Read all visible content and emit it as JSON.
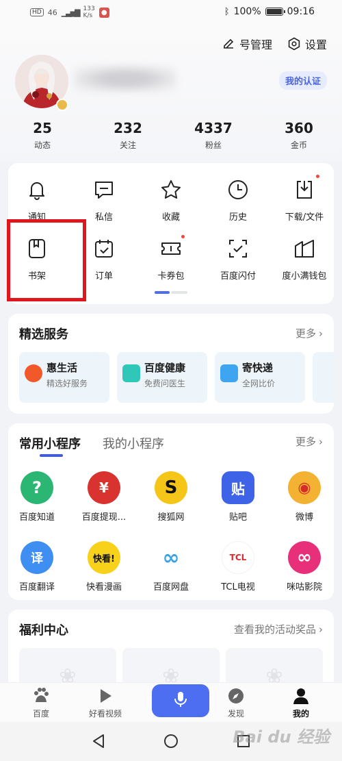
{
  "status_bar": {
    "network": "46",
    "speed_value": "133",
    "speed_unit": "K/s",
    "battery": "100%",
    "time": "09:16"
  },
  "header": {
    "account_mgmt_label": "号管理",
    "settings_label": "设置",
    "certification_label": "我的认证"
  },
  "stats": [
    {
      "value": "25",
      "label": "动态"
    },
    {
      "value": "232",
      "label": "关注"
    },
    {
      "value": "4337",
      "label": "粉丝"
    },
    {
      "value": "360",
      "label": "金币"
    }
  ],
  "quick_actions": [
    {
      "label": "通知",
      "icon": "bell-icon"
    },
    {
      "label": "私信",
      "icon": "message-icon"
    },
    {
      "label": "收藏",
      "icon": "star-icon"
    },
    {
      "label": "历史",
      "icon": "clock-icon"
    },
    {
      "label": "下载/文件",
      "icon": "download-icon",
      "dot": true
    },
    {
      "label": "书架",
      "icon": "bookshelf-icon",
      "highlighted": true
    },
    {
      "label": "订单",
      "icon": "order-icon"
    },
    {
      "label": "卡券包",
      "icon": "ticket-icon",
      "dot": true
    },
    {
      "label": "百度闪付",
      "icon": "scan-pay-icon"
    },
    {
      "label": "度小满钱包",
      "icon": "wallet-icon"
    }
  ],
  "services": {
    "title": "精选服务",
    "more": "更多",
    "items": [
      {
        "title": "惠生活",
        "subtitle": "精选好服务",
        "icon_color": "#f2592a"
      },
      {
        "title": "百度健康",
        "subtitle": "免费问医生",
        "icon_color": "#2fc7b8"
      },
      {
        "title": "寄快递",
        "subtitle": "全网比价",
        "icon_color": "#3ea5f0"
      }
    ]
  },
  "mini_programs": {
    "tab_common": "常用小程序",
    "tab_mine": "我的小程序",
    "more": "更多",
    "apps": [
      {
        "label": "百度知道",
        "color": "#2bb673",
        "glyph": "?"
      },
      {
        "label": "百度提现...",
        "color": "#d9332f",
        "glyph": "¥"
      },
      {
        "label": "搜狐网",
        "color": "#f5c518",
        "glyph": "S"
      },
      {
        "label": "贴吧",
        "color": "#3f63e6",
        "glyph": "贴"
      },
      {
        "label": "微博",
        "color": "#f4b233",
        "glyph": "◉"
      },
      {
        "label": "百度翻译",
        "color": "#3f8ef2",
        "glyph": "译"
      },
      {
        "label": "快看漫画",
        "color": "#f8d21a",
        "glyph": "快看!"
      },
      {
        "label": "百度网盘",
        "color": "#5ab0f0",
        "glyph": "∞"
      },
      {
        "label": "TCL电视",
        "color": "#e0282e",
        "glyph": "TCL"
      },
      {
        "label": "咪咕影院",
        "color": "#e8307a",
        "glyph": "∞"
      }
    ]
  },
  "welfare": {
    "title": "福利中心",
    "link": "查看我的活动奖品"
  },
  "bottom_nav": [
    {
      "label": "百度"
    },
    {
      "label": "好看视频"
    },
    {
      "label": "发现"
    },
    {
      "label": "我的"
    }
  ],
  "watermark": "Bai du 经验",
  "colors": {
    "accent": "#4e6ef2",
    "highlight_box": "#e0161e"
  }
}
